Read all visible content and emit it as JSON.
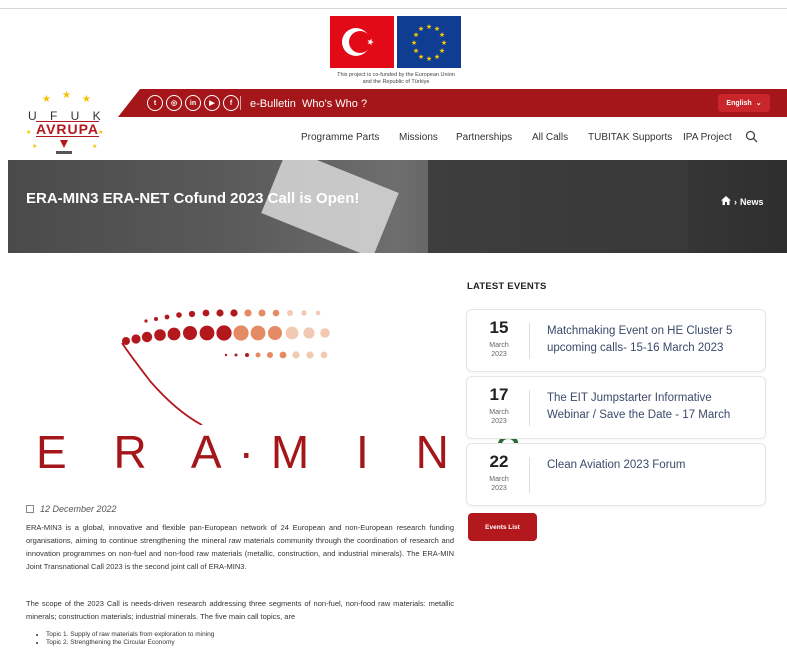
{
  "header": {
    "cofund_line1": "This project is co-funded by the European Union",
    "cofund_line2": "and the Republic of Türkiye",
    "logo": {
      "top": "U F U K",
      "main": "AVRUPA"
    },
    "social": [
      "t",
      "ig",
      "in",
      "yt",
      "f"
    ],
    "ebulletin": "e-Bulletin",
    "whoswho": "Who's Who ?",
    "language": "English"
  },
  "nav": {
    "items": [
      "Programme Parts",
      "Missions",
      "Partnerships",
      "All Calls",
      "TUBITAK Supports",
      "IPA Project"
    ]
  },
  "hero": {
    "title": "ERA-MIN3 ERA-NET Cofund 2023 Call is Open!",
    "breadcrumb": "News"
  },
  "article": {
    "image_text_main": "E R A·M I N ",
    "image_text_end": "3",
    "date": "12 December 2022",
    "para1": "ERA-MIN3 is a global, innovative and flexible pan-European network of 24 European and non-European research funding organisations, aiming to continue strengthening the mineral raw materials community through the coordination of research and innovation programmes on non-fuel and non-food raw materials (metallic, construction, and industrial minerals). The ERA-MIN Joint Transnational Call 2023 is the second joint call of ERA-MIN3.",
    "para2": "The scope of the 2023 Call is needs-driven research addressing three segments of non-fuel, non-food raw materials: metallic minerals; construction materials; industrial minerals. The five main call topics, are",
    "topics": [
      "Topic 1. Supply of raw materials from exploration to mining",
      "Topic 2. Strengthening the Circular Economy"
    ]
  },
  "sidebar": {
    "heading": "LATEST EVENTS",
    "events": [
      {
        "day": "15",
        "month": "March",
        "year": "2023",
        "title": "Matchmaking Event on HE Cluster 5 upcoming calls- 15-16 March 2023"
      },
      {
        "day": "17",
        "month": "March",
        "year": "2023",
        "title": "The EIT Jumpstarter Informative Webinar / Save the Date - 17 March"
      },
      {
        "day": "22",
        "month": "March",
        "year": "2023",
        "title": "Clean Aviation 2023 Forum"
      }
    ],
    "events_list_button": "Events List"
  },
  "colors": {
    "brand_red": "#a5161a",
    "accent_green": "#2f6d3a",
    "link_blue": "#3a4a6a"
  }
}
